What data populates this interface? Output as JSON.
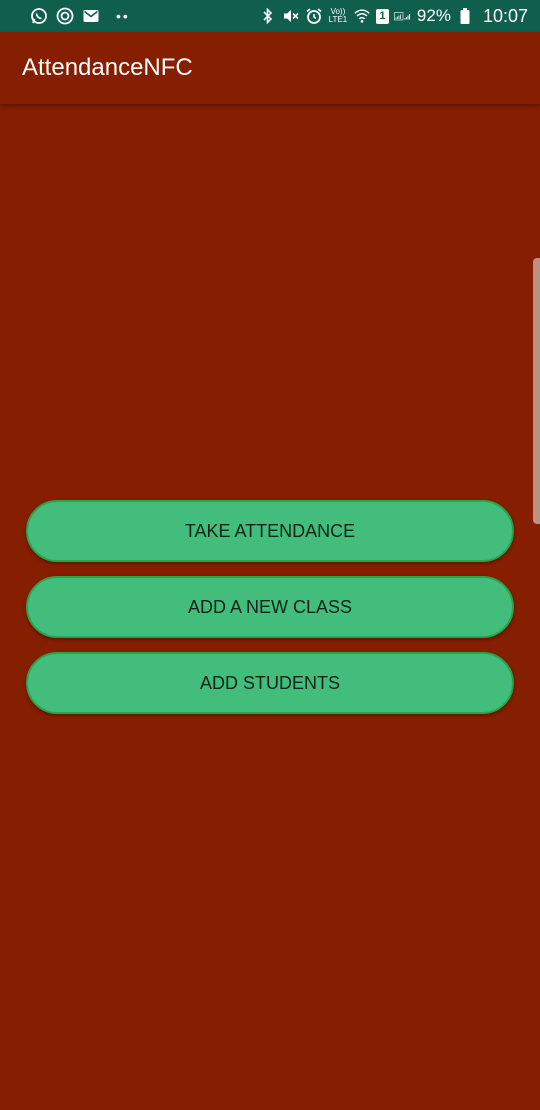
{
  "status_bar": {
    "battery_percent": "92%",
    "time": "10:07",
    "volte_top": "Vo))",
    "volte_bottom": "LTE1",
    "sim_slot": "1",
    "icons": [
      "whatsapp-icon",
      "circular-app-icon",
      "mail-icon",
      "bluetooth-icon",
      "mute-icon",
      "alarm-icon",
      "volte-icon",
      "wifi-icon",
      "sim-icon",
      "signal-icon",
      "battery-icon"
    ],
    "background_color": "#0f5f4c"
  },
  "app_bar": {
    "title": "AttendanceNFC",
    "background_color": "#861e01"
  },
  "main": {
    "background_color": "#861e01",
    "buttons": [
      {
        "label": "TAKE ATTENDANCE"
      },
      {
        "label": "ADD A NEW CLASS"
      },
      {
        "label": "ADD STUDENTS"
      }
    ],
    "button_color": "#42bd7b",
    "button_border_color": "#2aa34a"
  }
}
